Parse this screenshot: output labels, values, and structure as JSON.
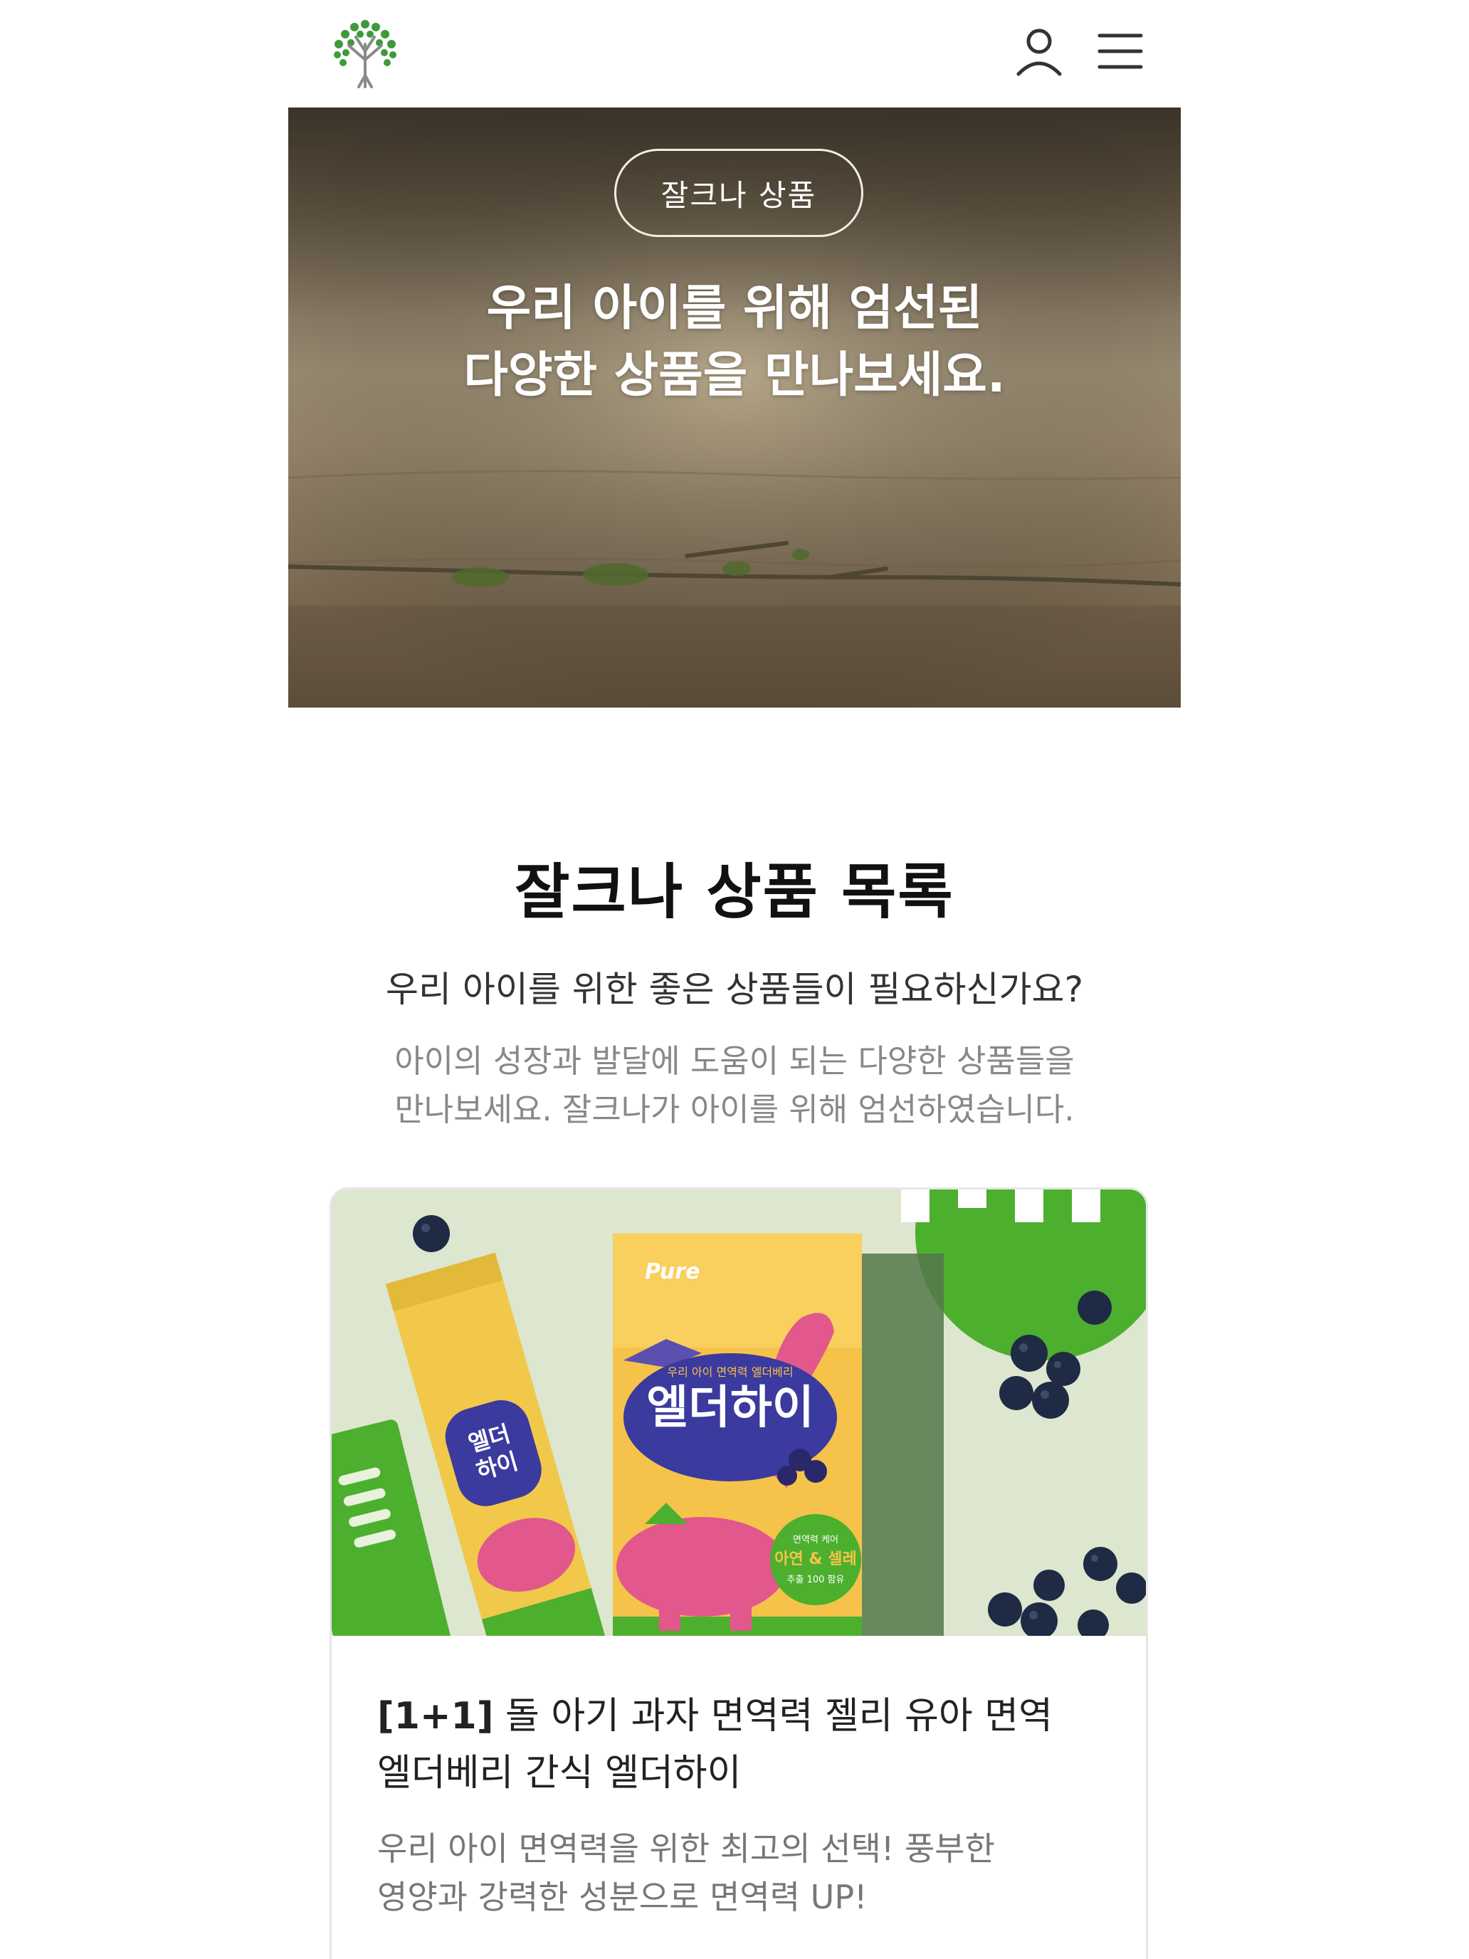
{
  "header": {
    "logo_alt": "잘크나",
    "icons": {
      "logo": "tree-logo",
      "user": "user-icon",
      "menu": "hamburger-menu-icon"
    }
  },
  "hero": {
    "badge": "잘크나 상품",
    "title_line1": "우리 아이를 위해 엄선된",
    "title_line2": "다양한 상품을 만나보세요."
  },
  "section": {
    "title": "잘크나 상품 목록",
    "subtitle": "우리 아이를 위한 좋은 상품들이 필요하신가요?",
    "desc_line1": "아이의 성장과 발달에 도움이 되는 다양한 상품들을",
    "desc_line2": "만나보세요. 잘크나가 아이를 위해 엄선하였습니다."
  },
  "products": [
    {
      "badge": "[1+1]",
      "title_rest": " 돌 아기 과자 면역력 젤리 유아 면역",
      "title_line2": "엘더베리 간식 엘더하이",
      "desc_line1": "우리 아이 면역력을 위한 최고의 선택! 풍부한",
      "desc_line2": "영양과 강력한 성분으로 면역력 UP!",
      "image": {
        "brand": "Pure",
        "box_text": "엘더하이",
        "box_tagline": "우리 아이 면역력 엘더베리",
        "stick_text_1": "엘더",
        "stick_text_2": "하이",
        "box_badge_top": "면역력 케어",
        "box_badge_main": "아연 & 셀레",
        "box_badge_bottom": "추출 100 함유"
      }
    }
  ],
  "colors": {
    "accent_green": "#4caf2e",
    "box_yellow": "#f6c34a",
    "box_purple": "#3b3a9e",
    "dino_pink": "#e2578c",
    "text_dark": "#222222",
    "text_muted": "#888888"
  }
}
